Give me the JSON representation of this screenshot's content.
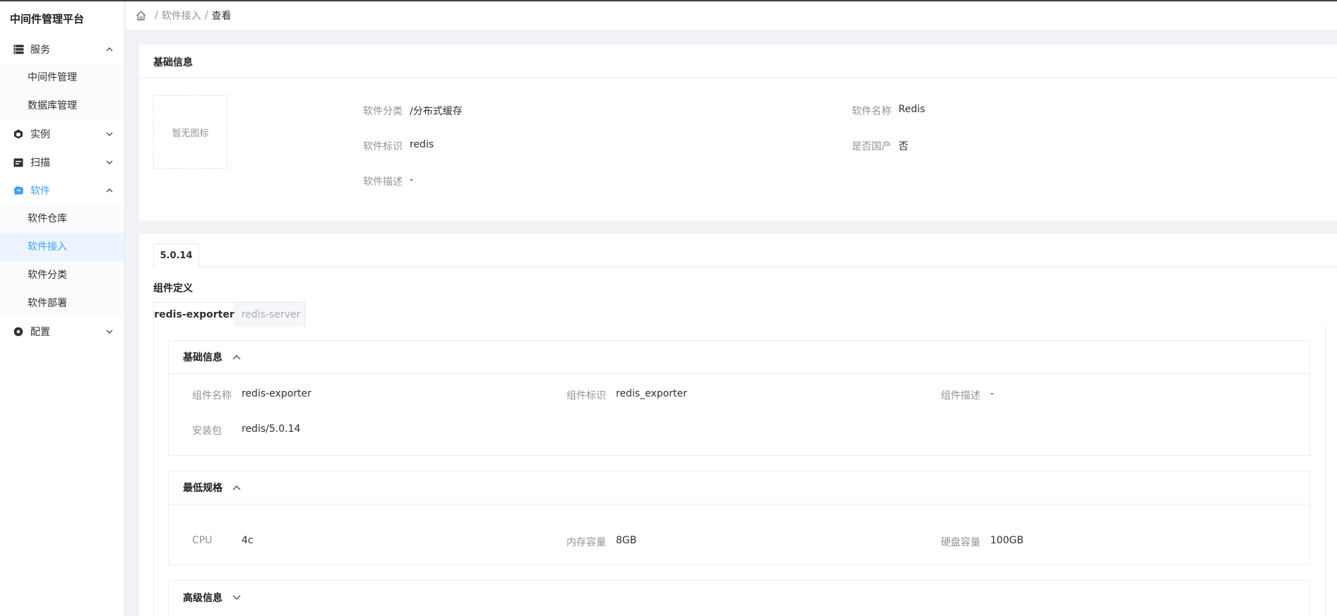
{
  "app": {
    "title": "中间件管理平台"
  },
  "sidebar": {
    "groups": [
      {
        "label": "服务",
        "icon": "server-icon",
        "expanded": true,
        "items": [
          "中间件管理",
          "数据库管理"
        ]
      },
      {
        "label": "实例",
        "icon": "cube-icon",
        "expanded": false,
        "items": []
      },
      {
        "label": "扫描",
        "icon": "scan-icon",
        "expanded": false,
        "items": []
      },
      {
        "label": "软件",
        "icon": "box-icon",
        "expanded": true,
        "items": [
          "软件仓库",
          "软件接入",
          "软件分类",
          "软件部署"
        ]
      },
      {
        "label": "配置",
        "icon": "settings-icon",
        "expanded": false,
        "items": []
      }
    ],
    "active_item": "软件接入"
  },
  "breadcrumb": {
    "sep": "/",
    "items": [
      "软件接入",
      "查看"
    ]
  },
  "basic_info": {
    "title": "基础信息",
    "icon_placeholder": "暂无图标",
    "fields": {
      "category": {
        "label": "软件分类",
        "value": "/分布式缓存"
      },
      "name": {
        "label": "软件名称",
        "value": "Redis"
      },
      "identifier": {
        "label": "软件标识",
        "value": "redis"
      },
      "domestic": {
        "label": "是否国产",
        "value": "否"
      },
      "description": {
        "label": "软件描述",
        "value": "-"
      }
    }
  },
  "versions": {
    "tabs": [
      "5.0.14"
    ],
    "active": "5.0.14"
  },
  "components": {
    "title": "组件定义",
    "tabs": [
      "redis-exporter",
      "redis-server"
    ],
    "active": "redis-exporter",
    "basic": {
      "title": "基础信息",
      "fields": {
        "name": {
          "label": "组件名称",
          "value": "redis-exporter"
        },
        "identifier": {
          "label": "组件标识",
          "value": "redis_exporter"
        },
        "description": {
          "label": "组件描述",
          "value": "-"
        },
        "package": {
          "label": "安装包",
          "value": "redis/5.0.14"
        }
      }
    },
    "spec": {
      "title": "最低规格",
      "fields": {
        "cpu": {
          "label": "CPU",
          "value": "4c"
        },
        "memory": {
          "label": "内存容量",
          "value": "8GB"
        },
        "disk": {
          "label": "硬盘容量",
          "value": "100GB"
        }
      }
    },
    "advanced": {
      "title": "高级信息"
    }
  },
  "colors": {
    "accent": "#409eff",
    "active_bg": "#ecf5ff"
  }
}
